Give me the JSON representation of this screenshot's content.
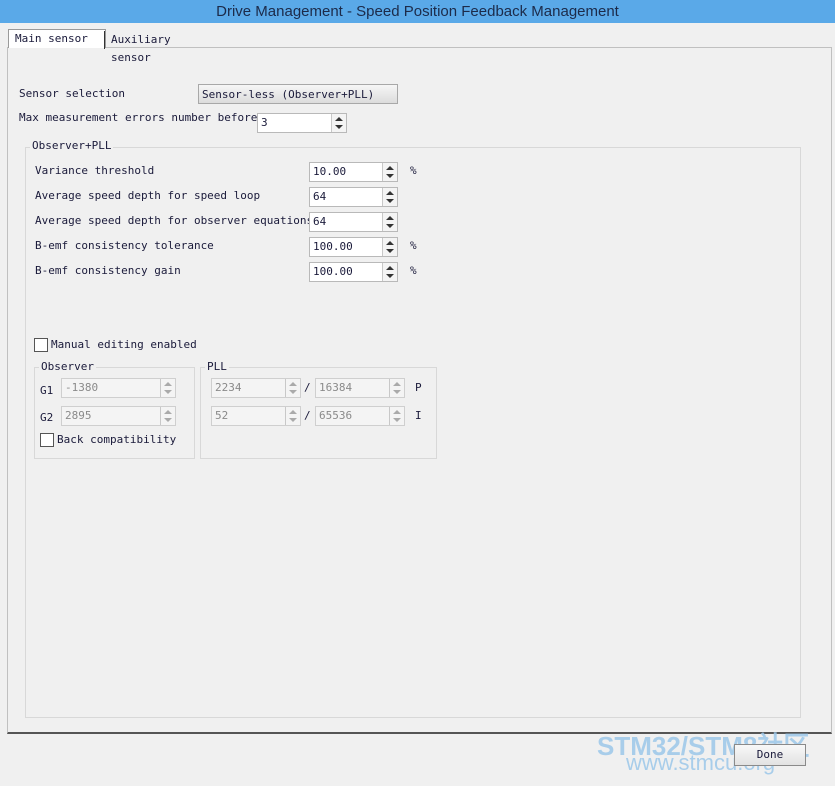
{
  "window": {
    "title": "Drive Management - Speed Position Feedback Management"
  },
  "tabs": [
    {
      "label": "Main sensor"
    },
    {
      "label": "Auxiliary sensor"
    }
  ],
  "sensor_selection": {
    "label": "Sensor selection",
    "value": "Sensor-less (Observer+PLL)"
  },
  "max_errors": {
    "label": "Max measurement errors number before",
    "value": "3"
  },
  "observer_pll_group": {
    "title": "Observer+PLL",
    "fields": [
      {
        "label": "Variance threshold",
        "value": "10.00",
        "unit": "%"
      },
      {
        "label": "Average speed depth for speed loop",
        "value": "64",
        "unit": ""
      },
      {
        "label": "Average speed depth for observer equations",
        "value": "64",
        "unit": ""
      },
      {
        "label": "B-emf consistency tolerance",
        "value": "100.00",
        "unit": "%"
      },
      {
        "label": "B-emf consistency gain",
        "value": "100.00",
        "unit": "%"
      }
    ],
    "manual_editing": {
      "label": "Manual editing enabled",
      "checked": false
    },
    "observer": {
      "title": "Observer",
      "g1_label": "G1",
      "g1_value": "-1380",
      "g2_label": "G2",
      "g2_value": "2895",
      "back_compat": {
        "label": "Back compatibility",
        "checked": false
      }
    },
    "pll": {
      "title": "PLL",
      "p_num": "2234",
      "p_den": "16384",
      "p_label": "P",
      "i_num": "52",
      "i_den": "65536",
      "i_label": "I",
      "separator": "/"
    }
  },
  "done_button": {
    "label": "Done"
  },
  "watermark": {
    "line1": "STM32/STM8社区",
    "line2": "www.stmcu.org"
  }
}
